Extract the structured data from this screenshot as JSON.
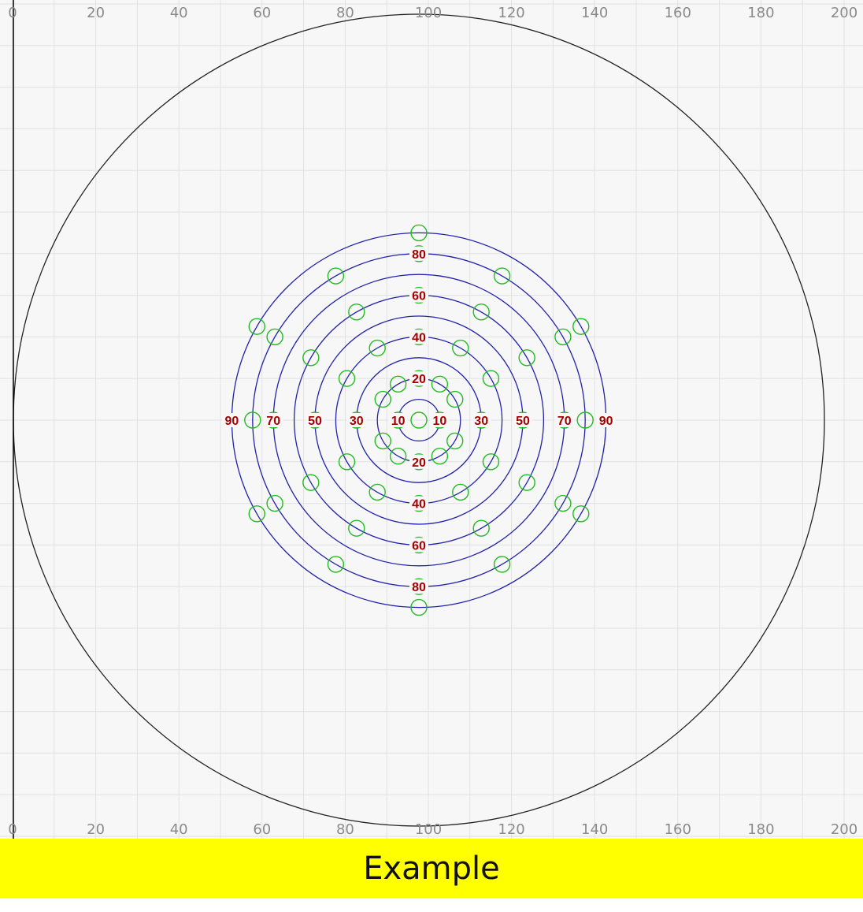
{
  "axis": {
    "ticks": [
      0,
      20,
      40,
      60,
      80,
      100,
      120,
      140,
      160,
      180,
      200
    ],
    "labels": [
      "0",
      "20",
      "40",
      "60",
      "80",
      "100",
      "120",
      "140",
      "160",
      "180",
      "200"
    ]
  },
  "rings": [
    {
      "radius": 10,
      "label": "10"
    },
    {
      "radius": 20,
      "label": "20"
    },
    {
      "radius": 30,
      "label": "30"
    },
    {
      "radius": 40,
      "label": "40"
    },
    {
      "radius": 50,
      "label": "50"
    },
    {
      "radius": 60,
      "label": "60"
    },
    {
      "radius": 70,
      "label": "70"
    },
    {
      "radius": 80,
      "label": "80"
    },
    {
      "radius": 90,
      "label": "90"
    }
  ],
  "colors": {
    "grid": "#e2e2e2",
    "axis": "#000000",
    "outer_circle": "#222222",
    "ring": "#2222aa",
    "marker": "#22bb22",
    "ring_label": "#a50000",
    "banner": "#ffff00"
  },
  "banner": {
    "text": "Example"
  }
}
